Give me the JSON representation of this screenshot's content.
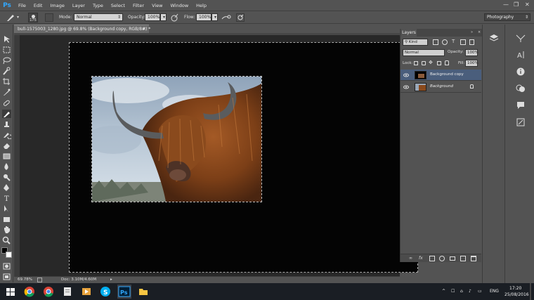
{
  "menu": {
    "logo": "Ps",
    "items": [
      "File",
      "Edit",
      "Image",
      "Layer",
      "Type",
      "Select",
      "Filter",
      "View",
      "Window",
      "Help"
    ]
  },
  "options": {
    "brush_size": "175",
    "mode_label": "Mode:",
    "mode_value": "Normal",
    "opacity_label": "Opacity:",
    "opacity_value": "100%",
    "flow_label": "Flow:",
    "flow_value": "100%",
    "workspace": "Photography"
  },
  "document": {
    "tab_title": "bull-1575003_1280.jpg @ 69.8% (Background copy, RGB/8#) *",
    "zoom": "69.78%",
    "doc_info": "Doc: 3.10M/4.60M"
  },
  "layers_panel": {
    "tab_label": "Layers",
    "filter_value": "Kind",
    "blend_mode": "Normal",
    "opacity_label": "Opacity:",
    "opacity_value": "100%",
    "lock_label": "Lock:",
    "fill_label": "Fill:",
    "fill_value": "100%",
    "layers": [
      {
        "name": "Background copy",
        "selected": true,
        "locked": false
      },
      {
        "name": "Background",
        "selected": false,
        "locked": true
      }
    ]
  },
  "taskbar": {
    "language": "ENG",
    "time": "17:20",
    "date": "25/08/2016"
  },
  "colors": {
    "ui_bg": "#535353",
    "workspace": "#282828",
    "selection": "#4a5e7c",
    "ps_blue": "#31a8ff"
  }
}
